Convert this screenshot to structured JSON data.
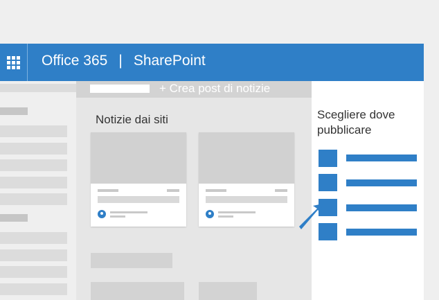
{
  "header": {
    "app_name": "Office 365",
    "separator": "|",
    "site_name": "SharePoint",
    "waffle_icon": "app-launcher-icon"
  },
  "command_bar": {
    "create_news_label": "+ Crea post di notizie"
  },
  "news": {
    "title": "Notizie dai siti"
  },
  "panel": {
    "title": "Scegliere dove pubblicare",
    "options_count_visible": 4
  },
  "colors": {
    "accent": "#2f7fc7",
    "background": "#efefef",
    "content_bg": "#e6e6e6",
    "placeholder": "#d3d3d3"
  },
  "icons": [
    "app-launcher-icon",
    "avatar-icon",
    "pointer-arrow-icon"
  ]
}
